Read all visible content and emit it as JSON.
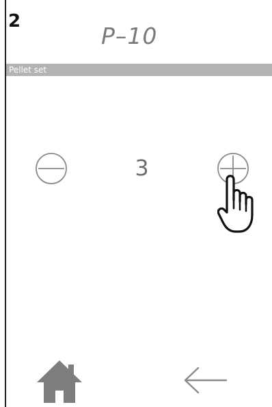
{
  "header": {
    "step_number": "2",
    "title": "P–10"
  },
  "section": {
    "label": "Pellet set"
  },
  "control": {
    "value": "3"
  },
  "icons": {
    "minus": "minus-circle-icon",
    "plus": "plus-circle-icon",
    "cursor": "pointing-hand-cursor-icon",
    "home": "home-icon",
    "back": "arrow-left-icon"
  },
  "colors": {
    "section_bar": "#b3b3b3",
    "icon_gray": "#8a8a8a",
    "home_icon": "#7d7d7d",
    "text_dark": "#111111"
  }
}
